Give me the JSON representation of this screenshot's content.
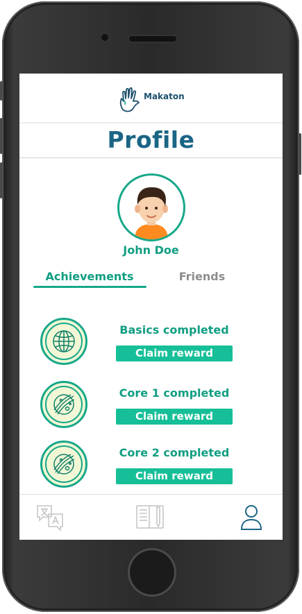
{
  "app": {
    "logo_text": "Makaton"
  },
  "page": {
    "title": "Profile"
  },
  "user": {
    "name": "John Doe"
  },
  "tabs": [
    {
      "label": "Achievements",
      "active": true
    },
    {
      "label": "Friends",
      "active": false
    }
  ],
  "achievements": [
    {
      "title": "Basics completed",
      "button_label": "Claim reward",
      "icon": "globe-icon"
    },
    {
      "title": "Core 1 completed",
      "button_label": "Claim reward",
      "icon": "planet-icon"
    },
    {
      "title": "Core 2 completed",
      "button_label": "Claim reward",
      "icon": "planet-icon"
    }
  ],
  "bottom_nav": [
    {
      "icon": "translate-icon",
      "active": false
    },
    {
      "icon": "notebook-icon",
      "active": false
    },
    {
      "icon": "profile-icon",
      "active": true
    }
  ],
  "colors": {
    "accent": "#16a888",
    "title": "#1b6585",
    "button": "#16bf97",
    "badge_bg": "#f2f7d6"
  }
}
